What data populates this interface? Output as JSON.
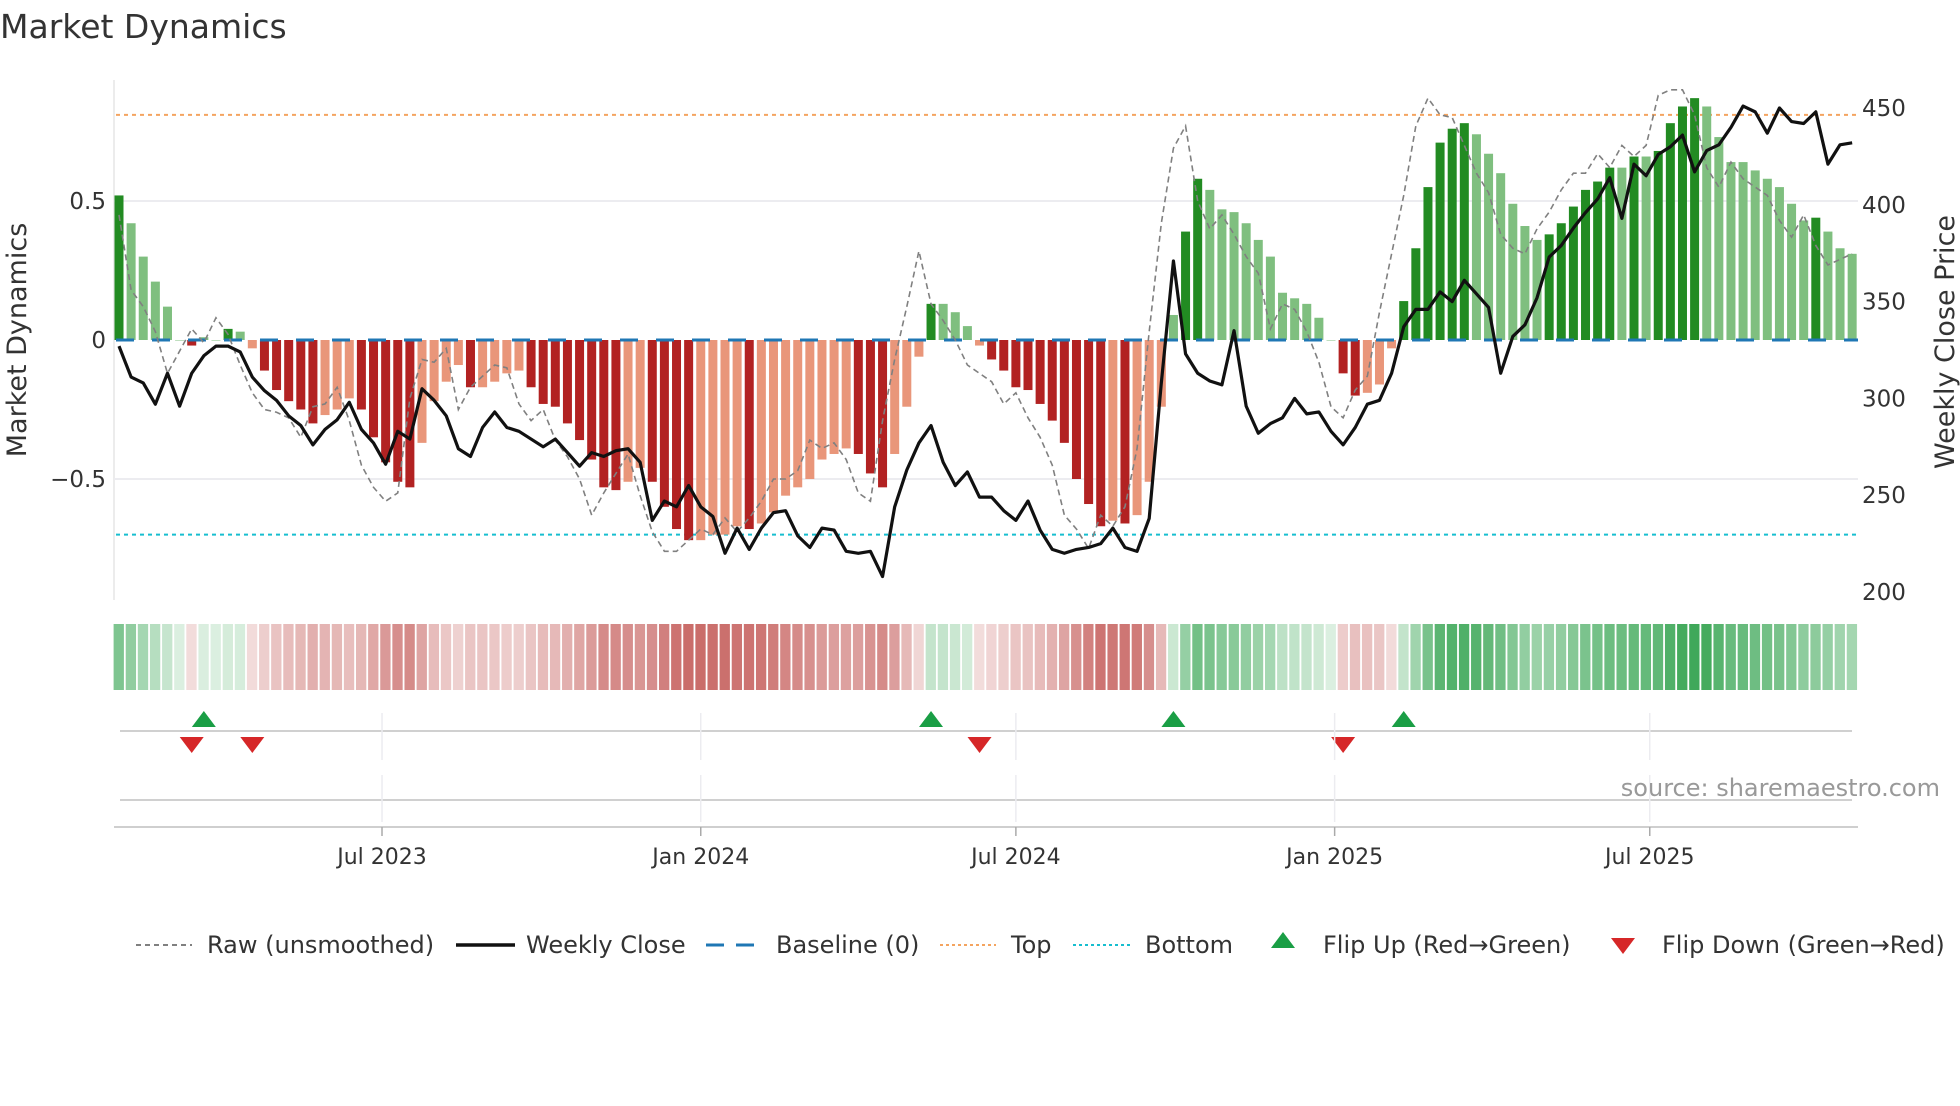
{
  "title": "Market Dynamics",
  "source": "source: sharemaestro.com",
  "colors": {
    "dark_green": "#228b22",
    "light_green": "#7fbf7f",
    "dark_red": "#b22222",
    "light_red": "#e9967a",
    "close": "#111111",
    "raw": "#808080",
    "baseline": "#1f77b4",
    "top": "#f4a460",
    "bottom": "#17becf",
    "flip_up": "#1a9e45",
    "flip_down": "#d62728",
    "strip_green": "#3aa655",
    "strip_red": "#c0504d"
  },
  "legend": {
    "raw": "Raw (unsmoothed)",
    "close": "Weekly Close",
    "baseline": "Baseline (0)",
    "top": "Top",
    "bottom": "Bottom",
    "flip_up": "Flip Up (Red→Green)",
    "flip_down": "Flip Down (Green→Red)"
  },
  "chart_data": {
    "type": "bar",
    "title": "Market Dynamics",
    "ylabel": "Market Dynamics",
    "y2label": "Weekly Close Price",
    "ylim": [
      -0.93,
      0.93
    ],
    "y2lim": [
      200,
      460
    ],
    "yticks": [
      {
        "v": 0.5,
        "label": "0.5"
      },
      {
        "v": 0,
        "label": "0"
      },
      {
        "v": -0.5,
        "label": "−0.5"
      }
    ],
    "y2ticks": [
      {
        "v": 450,
        "label": "450"
      },
      {
        "v": 400,
        "label": "400"
      },
      {
        "v": 350,
        "label": "350"
      },
      {
        "v": 300,
        "label": "300"
      },
      {
        "v": 250,
        "label": "250"
      },
      {
        "v": 200,
        "label": "200"
      }
    ],
    "xticks": [
      {
        "week": 21.7,
        "label": "Jul 2023"
      },
      {
        "week": 48.0,
        "label": "Jan 2024"
      },
      {
        "week": 74.0,
        "label": "Jul 2024"
      },
      {
        "week": 100.3,
        "label": "Jan 2025"
      },
      {
        "week": 126.3,
        "label": "Jul 2025"
      }
    ],
    "top_level": 0.81,
    "bottom_level": -0.7,
    "baseline": 0,
    "values": [
      0.52,
      0.42,
      0.3,
      0.21,
      0.12,
      0.0,
      -0.02,
      0.01,
      0.0,
      0.04,
      0.03,
      -0.03,
      -0.11,
      -0.18,
      -0.22,
      -0.25,
      -0.3,
      -0.27,
      -0.25,
      -0.21,
      -0.25,
      -0.35,
      -0.44,
      -0.51,
      -0.53,
      -0.37,
      -0.22,
      -0.15,
      -0.09,
      -0.17,
      -0.17,
      -0.15,
      -0.12,
      -0.11,
      -0.17,
      -0.23,
      -0.24,
      -0.3,
      -0.36,
      -0.43,
      -0.53,
      -0.54,
      -0.51,
      -0.46,
      -0.51,
      -0.6,
      -0.68,
      -0.72,
      -0.72,
      -0.7,
      -0.7,
      -0.67,
      -0.68,
      -0.66,
      -0.62,
      -0.56,
      -0.53,
      -0.5,
      -0.43,
      -0.41,
      -0.39,
      -0.41,
      -0.48,
      -0.53,
      -0.41,
      -0.24,
      -0.06,
      0.13,
      0.13,
      0.1,
      0.05,
      -0.02,
      -0.07,
      -0.11,
      -0.17,
      -0.18,
      -0.23,
      -0.29,
      -0.37,
      -0.5,
      -0.59,
      -0.67,
      -0.65,
      -0.66,
      -0.63,
      -0.51,
      -0.24,
      0.09,
      0.39,
      0.58,
      0.54,
      0.47,
      0.46,
      0.42,
      0.36,
      0.3,
      0.17,
      0.15,
      0.13,
      0.08,
      0.0,
      -0.12,
      -0.2,
      -0.19,
      -0.16,
      -0.03,
      0.14,
      0.33,
      0.55,
      0.71,
      0.76,
      0.78,
      0.74,
      0.67,
      0.6,
      0.49,
      0.41,
      0.36,
      0.38,
      0.42,
      0.48,
      0.54,
      0.57,
      0.62,
      0.62,
      0.66,
      0.66,
      0.68,
      0.78,
      0.84,
      0.87,
      0.84,
      0.73,
      0.64,
      0.64,
      0.61,
      0.58,
      0.55,
      0.49,
      0.43,
      0.44,
      0.39,
      0.33,
      0.31
    ],
    "raw": [
      0.45,
      0.18,
      0.12,
      0.03,
      -0.12,
      -0.04,
      0.04,
      -0.01,
      0.08,
      0.02,
      -0.09,
      -0.19,
      -0.25,
      -0.26,
      -0.28,
      -0.35,
      -0.24,
      -0.23,
      -0.17,
      -0.29,
      -0.45,
      -0.53,
      -0.58,
      -0.55,
      -0.21,
      -0.07,
      -0.08,
      -0.03,
      -0.25,
      -0.17,
      -0.13,
      -0.09,
      -0.1,
      -0.23,
      -0.29,
      -0.25,
      -0.36,
      -0.42,
      -0.5,
      -0.63,
      -0.55,
      -0.48,
      -0.41,
      -0.56,
      -0.69,
      -0.76,
      -0.76,
      -0.72,
      -0.68,
      -0.7,
      -0.64,
      -0.69,
      -0.64,
      -0.58,
      -0.5,
      -0.5,
      -0.47,
      -0.36,
      -0.39,
      -0.37,
      -0.43,
      -0.55,
      -0.58,
      -0.29,
      -0.07,
      0.12,
      0.32,
      0.13,
      0.07,
      0.0,
      -0.09,
      -0.12,
      -0.15,
      -0.23,
      -0.19,
      -0.28,
      -0.35,
      -0.45,
      -0.63,
      -0.68,
      -0.75,
      -0.63,
      -0.67,
      -0.6,
      -0.39,
      0.03,
      0.42,
      0.69,
      0.77,
      0.5,
      0.4,
      0.45,
      0.38,
      0.3,
      0.24,
      0.04,
      0.13,
      0.11,
      0.03,
      -0.08,
      -0.24,
      -0.28,
      -0.18,
      -0.13,
      0.1,
      0.31,
      0.52,
      0.77,
      0.87,
      0.81,
      0.8,
      0.7,
      0.6,
      0.53,
      0.38,
      0.33,
      0.31,
      0.4,
      0.46,
      0.54,
      0.6,
      0.6,
      0.67,
      0.62,
      0.7,
      0.66,
      0.7,
      0.88,
      0.9,
      0.9,
      0.81,
      0.62,
      0.55,
      0.64,
      0.58,
      0.55,
      0.52,
      0.43,
      0.37,
      0.45,
      0.34,
      0.27,
      0.29,
      0.31
    ],
    "close": [
      327,
      311,
      308,
      297,
      313,
      296,
      313,
      322,
      327,
      327,
      324,
      311,
      304,
      299,
      291,
      286,
      276,
      284,
      289,
      298,
      284,
      277,
      266,
      283,
      279,
      305,
      299,
      291,
      274,
      270,
      285,
      293,
      285,
      283,
      279,
      275,
      279,
      272,
      265,
      272,
      270,
      273,
      274,
      267,
      237,
      247,
      244,
      255,
      244,
      239,
      220,
      233,
      222,
      233,
      241,
      242,
      229,
      223,
      233,
      232,
      221,
      220,
      221,
      208,
      244,
      263,
      277,
      286,
      267,
      255,
      262,
      249,
      249,
      242,
      237,
      247,
      232,
      222,
      220,
      222,
      223,
      225,
      233,
      223,
      221,
      238,
      308,
      371,
      323,
      313,
      309,
      307,
      335,
      296,
      282,
      287,
      290,
      300,
      292,
      293,
      283,
      276,
      285,
      297,
      299,
      313,
      337,
      346,
      346,
      355,
      350,
      361,
      354,
      347,
      313,
      332,
      338,
      352,
      373,
      379,
      388,
      396,
      403,
      414,
      393,
      421,
      415,
      426,
      430,
      436,
      417,
      428,
      431,
      440,
      451,
      448,
      437,
      450,
      443,
      442,
      448,
      421,
      431,
      432
    ],
    "flips_up_week": [
      7,
      67,
      87,
      106
    ],
    "flips_down_week": [
      6,
      11,
      71,
      101
    ],
    "legend_position": "bottom"
  }
}
